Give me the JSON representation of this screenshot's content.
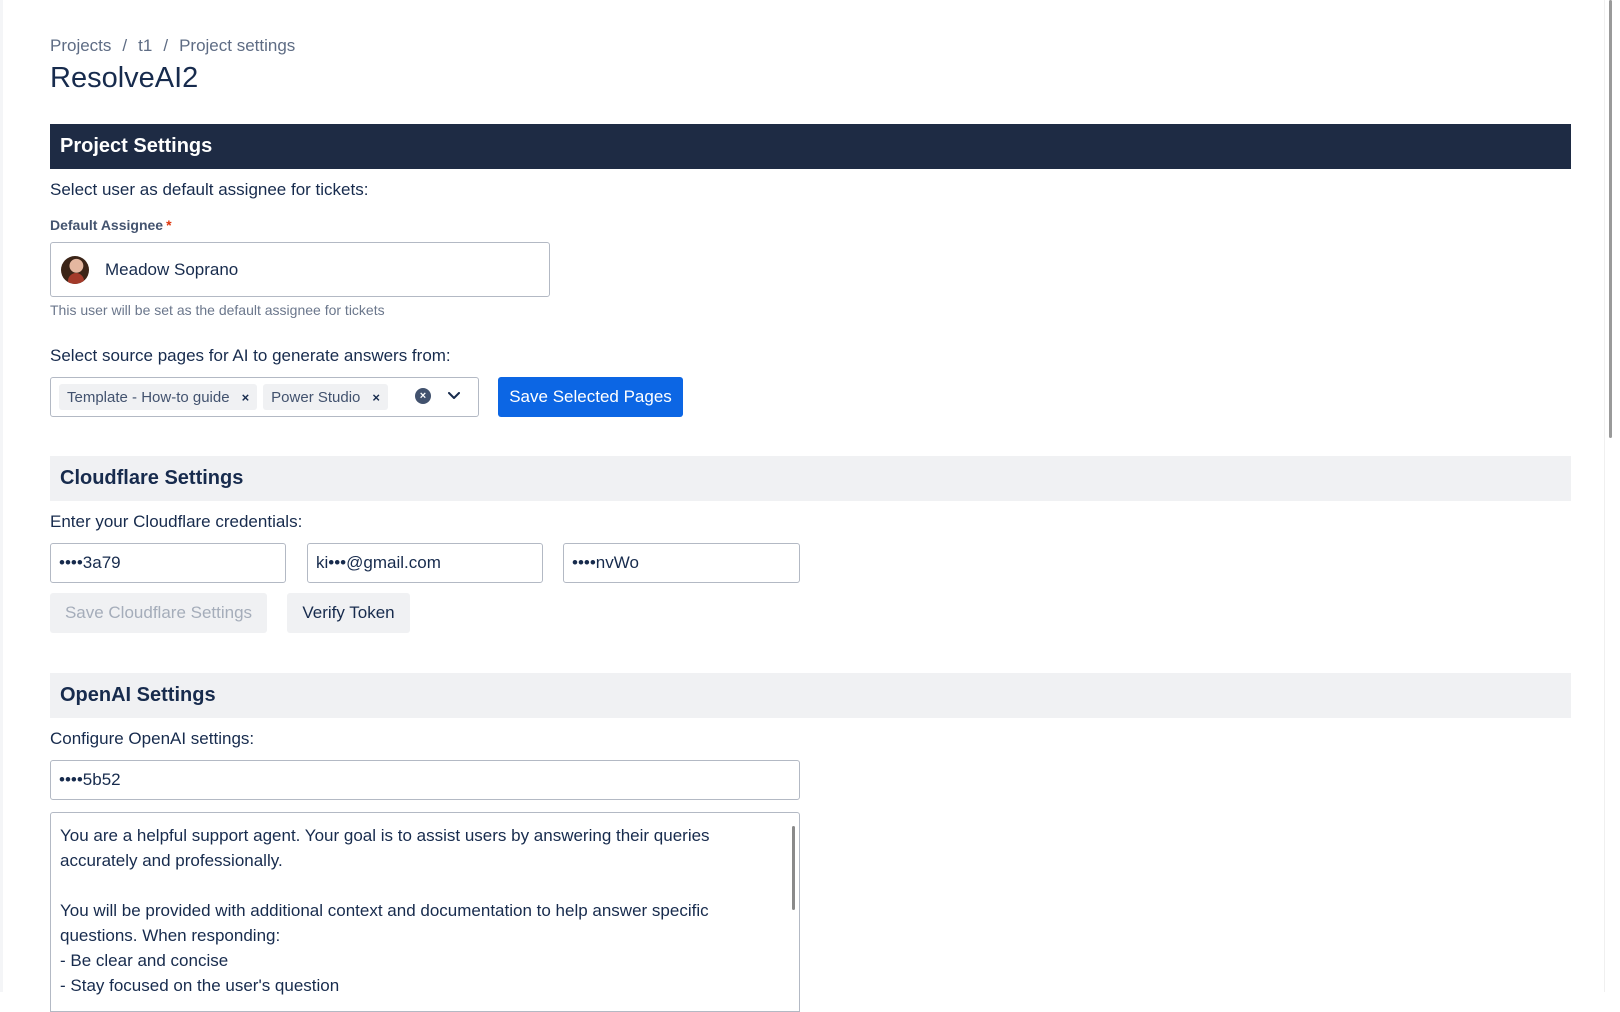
{
  "breadcrumb": [
    "Projects",
    "t1",
    "Project settings"
  ],
  "page_title": "ResolveAI2",
  "project_settings": {
    "header": "Project Settings",
    "assignee_prompt": "Select user as default assignee for tickets:",
    "assignee_label": "Default Assignee",
    "required_marker": "*",
    "assignee_value": "Meadow Soprano",
    "assignee_helper": "This user will be set as the default assignee for tickets",
    "pages_prompt": "Select source pages for AI to generate answers from:",
    "selected_pages": [
      "Template - How-to guide",
      "Power Studio"
    ],
    "remove_tag_glyph": "×",
    "clear_glyph": "×",
    "save_pages_label": "Save Selected Pages"
  },
  "cloudflare": {
    "header": "Cloudflare Settings",
    "prompt": "Enter your Cloudflare credentials:",
    "field_1": "••••3a79",
    "field_2": "ki•••@gmail.com",
    "field_3": "••••nvWo",
    "save_label": "Save Cloudflare Settings",
    "verify_label": "Verify Token"
  },
  "openai": {
    "header": "OpenAI Settings",
    "prompt": "Configure OpenAI settings:",
    "api_key": "••••5b52",
    "system_prompt": "You are a helpful support agent. Your goal is to assist users by answering their queries\naccurately and professionally.\n\nYou will be provided with additional context and documentation to help answer specific\nquestions. When responding:\n- Be clear and concise\n- Stay focused on the user's question"
  },
  "colors": {
    "primary_button": "#0c66e4",
    "dark_header": "#1e2b44",
    "light_header": "#f0f1f3"
  },
  "icons": [
    "clear-icon",
    "chevron-down-icon",
    "avatar"
  ]
}
